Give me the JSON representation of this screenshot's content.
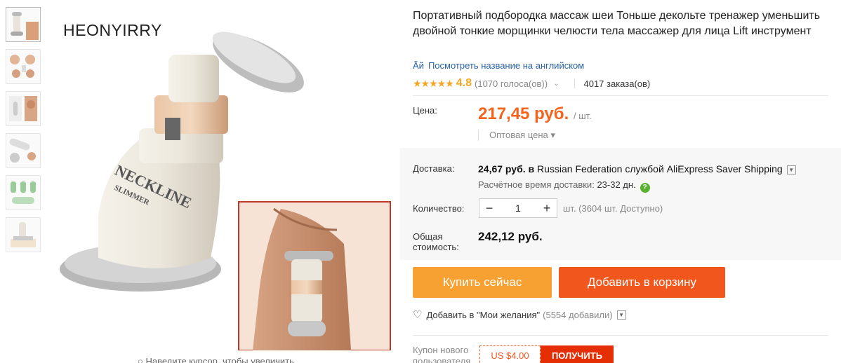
{
  "main_image": {
    "brand": "HEONYIRRY",
    "device_text": "NECKLINE SLIMMER",
    "zoom_hint": "Наведите курсор, чтобы увеличить"
  },
  "thumbnails": [
    {
      "name": "thumbnail-1"
    },
    {
      "name": "thumbnail-2"
    },
    {
      "name": "thumbnail-3"
    },
    {
      "name": "thumbnail-4"
    },
    {
      "name": "thumbnail-5"
    },
    {
      "name": "thumbnail-6"
    }
  ],
  "product": {
    "title": "Портативный подбородка массаж шеи Тоньше декольте тренажер уменьшить двойной тонкие морщинки челюсти тела массажер для лица Lift инструмент",
    "translate_link": "Посмотреть название на английском",
    "translate_icon": "translate-icon",
    "rating_stars": "★★★★★",
    "rating": "4.8",
    "votes": "(1070 голоса(ов))",
    "orders": "4017 заказа(ов)"
  },
  "price": {
    "label": "Цена:",
    "value": "217,45 руб.",
    "per": "/ шт.",
    "wholesale": "Оптовая цена ▾"
  },
  "shipping": {
    "label": "Доставка:",
    "cost": "24,67 руб.",
    "in_word": "в",
    "destination": "Russian Federation",
    "service_prefix": "службой",
    "service": "AliExpress Saver Shipping",
    "eta_label": "Расчётное время доставки:",
    "eta_value": "23-32 дн.",
    "help_icon": "question-icon"
  },
  "quantity": {
    "label": "Количество:",
    "minus": "−",
    "value": "1",
    "plus": "+",
    "available": "шт. (3604 шт. Доступно)"
  },
  "total": {
    "label_line1": "Общая",
    "label_line2": "стоимость:",
    "value": "242,12 руб."
  },
  "actions": {
    "buy_now": "Купить сейчас",
    "add_to_cart": "Добавить в корзину",
    "wishlist": "Добавить в \"Мои желания\"",
    "wishlist_count": "(5554 добавили)"
  },
  "coupon": {
    "label_line1": "Купон нового",
    "label_line2": "пользователя",
    "value": "US $4.00",
    "button": "ПОЛУЧИТЬ"
  },
  "colors": {
    "price": "#f5631c",
    "buy_now": "#f7a133",
    "add_to_cart": "#f1561d",
    "link": "#2962a8",
    "stars": "#f5a623"
  }
}
